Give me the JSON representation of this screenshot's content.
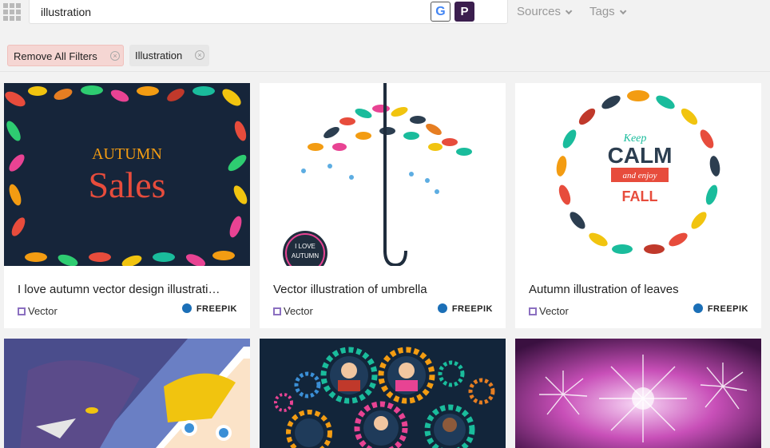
{
  "search": {
    "value": "illustration"
  },
  "engines": {
    "google": "G",
    "p": "P"
  },
  "menus": {
    "sources": "Sources",
    "tags": "Tags"
  },
  "filters": {
    "remove_all": "Remove All Filters",
    "active": "Illustration",
    "remove_glyph": "×"
  },
  "cards": [
    {
      "title": "I love autumn vector design illustrati…",
      "type": "Vector",
      "source": "FREEPIK",
      "art": [
        "AUTUMN",
        "Sales"
      ]
    },
    {
      "title": "Vector illustration of umbrella",
      "type": "Vector",
      "source": "FREEPIK",
      "art": [
        "I LOVE",
        "AUTUMN"
      ]
    },
    {
      "title": "Autumn illustration of leaves",
      "type": "Vector",
      "source": "FREEPIK",
      "art": [
        "Keep",
        "CALM",
        "and enjoy",
        "FALL"
      ]
    },
    {
      "title": "",
      "type": "",
      "source": ""
    },
    {
      "title": "",
      "type": "",
      "source": ""
    },
    {
      "title": "",
      "type": "",
      "source": ""
    }
  ]
}
